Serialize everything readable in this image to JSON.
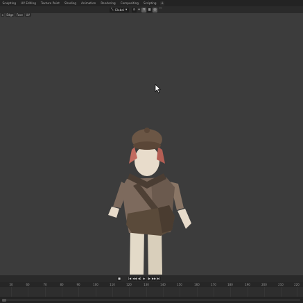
{
  "workspace_tabs": [
    "Sculpting",
    "UV Editing",
    "Texture Paint",
    "Shading",
    "Animation",
    "Rendering",
    "Compositing",
    "Scripting"
  ],
  "workspace_add_label": "+",
  "header": {
    "transform_orientation": "Global",
    "transform_icon": "⤡",
    "snap_icon": "magnet-icon",
    "proportional_icon": "proportional-edit-icon"
  },
  "select_modes": [
    "x",
    "Edge",
    "Face",
    "UV"
  ],
  "timeline": {
    "controls": [
      "■",
      "|◀",
      "◀◀",
      "◀|",
      "▶",
      "|▶",
      "▶▶",
      "▶|"
    ],
    "ticks": [
      "50",
      "60",
      "70",
      "80",
      "90",
      "100",
      "110",
      "120",
      "130",
      "140",
      "150",
      "160",
      "170",
      "180",
      "190",
      "200",
      "210",
      "220"
    ]
  },
  "colors": {
    "viewport_bg": "#3c3c3c",
    "hat": "#6b5645",
    "hair": "#c26b5f",
    "skin": "#e8dccb",
    "coat": "#7d6a5d",
    "bag": "#5a4a3a",
    "pants": "#e3dac8"
  }
}
